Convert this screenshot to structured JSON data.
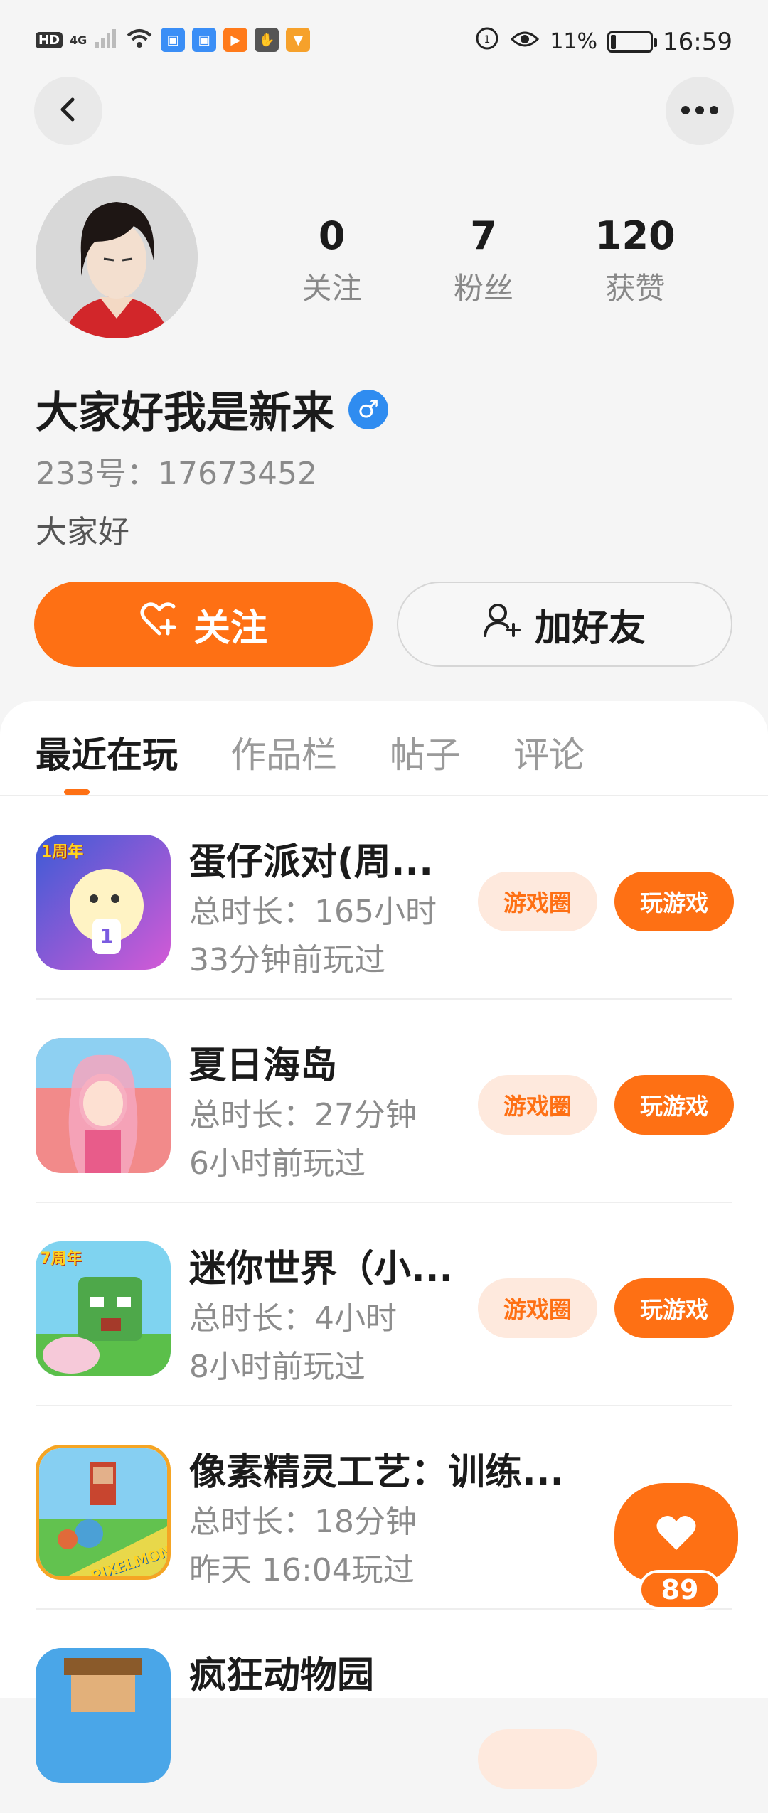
{
  "status_bar": {
    "left_labels": [
      "HD",
      "4G"
    ],
    "battery_percent": "11%",
    "time": "16:59",
    "colors": {
      "icon1": "#3a8ef6",
      "icon2": "#3a8ef6",
      "icon3": "#ff7a1a",
      "icon4": "#555555",
      "icon5": "#f6a12b"
    }
  },
  "header": {
    "back_icon": "chevron-left-icon",
    "more_icon": "more-horizontal-icon"
  },
  "profile": {
    "stats": [
      {
        "value": "0",
        "label": "关注"
      },
      {
        "value": "7",
        "label": "粉丝"
      },
      {
        "value": "120",
        "label": "获赞"
      }
    ],
    "username": "大家好我是新来",
    "gender_symbol": "♂",
    "user_id": "233号：17673452",
    "bio": "大家好"
  },
  "actions": {
    "follow_label": "关注",
    "add_friend_label": "加好友"
  },
  "tabs": [
    {
      "label": "最近在玩",
      "active": true
    },
    {
      "label": "作品栏",
      "active": false
    },
    {
      "label": "帖子",
      "active": false
    },
    {
      "label": "评论",
      "active": false
    }
  ],
  "games": [
    {
      "title": "蛋仔派对(周...",
      "duration": "总时长：165小时",
      "last_played": "33分钟前玩过",
      "circle_label": "游戏圈",
      "play_label": "玩游戏",
      "icon_badge": "1周年"
    },
    {
      "title": "夏日海岛",
      "duration": "总时长：27分钟",
      "last_played": "6小时前玩过",
      "circle_label": "游戏圈",
      "play_label": "玩游戏",
      "icon_badge": ""
    },
    {
      "title": "迷你世界（小...",
      "duration": "总时长：4小时",
      "last_played": "8小时前玩过",
      "circle_label": "游戏圈",
      "play_label": "玩游戏",
      "icon_badge": "7周年"
    },
    {
      "title": "像素精灵工艺：训练...",
      "duration": "总时长：18分钟",
      "last_played": "昨天 16:04玩过",
      "circle_label": "",
      "play_label": "",
      "icon_badge": "PIXELMON"
    },
    {
      "title": "疯狂动物园",
      "duration": "",
      "last_played": "",
      "circle_label": "",
      "play_label": "",
      "icon_badge": ""
    }
  ],
  "floating_like": {
    "count": "89",
    "icon": "heart-icon"
  },
  "colors": {
    "accent": "#fe7014",
    "accent_light": "#fee9dd",
    "gender_badge": "#2f8cf0"
  }
}
